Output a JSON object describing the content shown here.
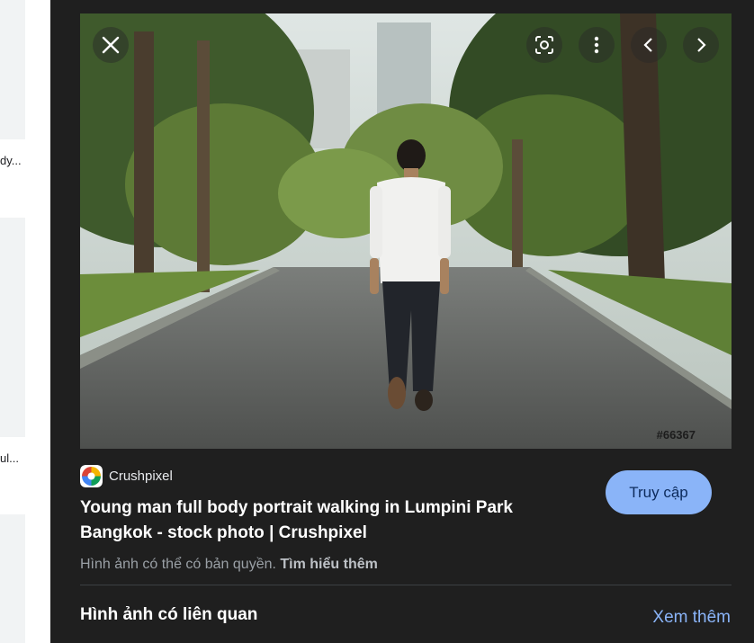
{
  "results": {
    "items": [
      {
        "caption": "dy..."
      },
      {
        "caption": "ul..."
      }
    ]
  },
  "viewer": {
    "photo_watermark_id": "#66367",
    "source": {
      "name": "Crushpixel"
    },
    "title": "Young man full body portrait walking in Lumpini Park Bangkok - stock photo | Crushpixel",
    "visit_label": "Truy cập",
    "copyright_notice": "Hình ảnh có thể có bản quyền.",
    "learn_more_label": "Tìm hiểu thêm",
    "related_heading": "Hình ảnh có liên quan",
    "see_more_label": "Xem thêm",
    "icons": {
      "close": "close-icon",
      "lens": "lens-icon",
      "more": "more-vert-icon",
      "prev": "chevron-left-icon",
      "next": "chevron-right-icon"
    },
    "colors": {
      "panel_bg": "#1f1f1f",
      "accent": "#8ab4f8"
    }
  }
}
